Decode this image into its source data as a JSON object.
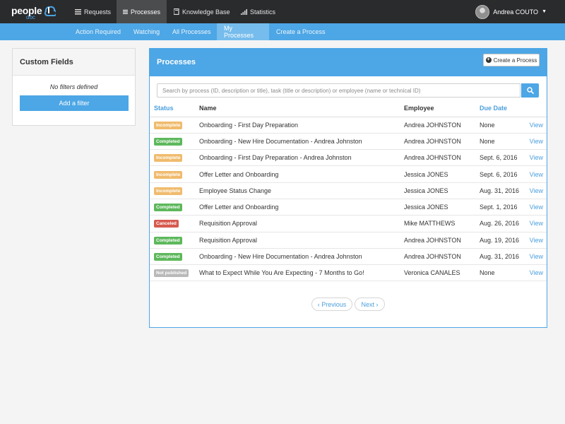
{
  "brand": {
    "word1": "people",
    "word2": "doc"
  },
  "topnav": [
    {
      "label": "Requests",
      "icon": "list-icon",
      "active": false
    },
    {
      "label": "Processes",
      "icon": "list-icon",
      "active": true
    },
    {
      "label": "Knowledge Base",
      "icon": "book-icon",
      "active": false
    },
    {
      "label": "Statistics",
      "icon": "bar-chart-icon",
      "active": false
    }
  ],
  "user": {
    "name": "Andrea COUTO"
  },
  "subnav": [
    {
      "label": "Action Required",
      "active": false
    },
    {
      "label": "Watching",
      "active": false
    },
    {
      "label": "All Processes",
      "active": false
    },
    {
      "label": "My Processes",
      "active": true
    },
    {
      "label": "Create a Process",
      "active": false
    }
  ],
  "custom_fields": {
    "title": "Custom Fields",
    "empty_text": "No filters defined",
    "add_label": "Add a filter"
  },
  "processes": {
    "title": "Processes",
    "create_label": "Create a Process",
    "search_placeholder": "Search by process (ID, description or title), task (title or description) or employee (name or technical ID)",
    "columns": {
      "status": "Status",
      "name": "Name",
      "employee": "Employee",
      "due": "Due Date"
    },
    "rows": [
      {
        "status": "Incomplete",
        "kind": "incomplete",
        "name": "Onboarding - First Day Preparation",
        "employee": "Andrea JOHNSTON",
        "due": "None",
        "action": "View"
      },
      {
        "status": "Completed",
        "kind": "completed",
        "name": "Onboarding - New Hire Documentation - Andrea Johnston",
        "employee": "Andrea JOHNSTON",
        "due": "None",
        "action": "View"
      },
      {
        "status": "Incomplete",
        "kind": "incomplete",
        "name": "Onboarding - First Day Preparation - Andrea Johnston",
        "employee": "Andrea JOHNSTON",
        "due": "Sept. 6, 2016",
        "action": "View"
      },
      {
        "status": "Incomplete",
        "kind": "incomplete",
        "name": "Offer Letter and Onboarding",
        "employee": "Jessica JONES",
        "due": "Sept. 6, 2016",
        "action": "View"
      },
      {
        "status": "Incomplete",
        "kind": "incomplete",
        "name": "Employee Status Change",
        "employee": "Jessica JONES",
        "due": "Aug. 31, 2016",
        "action": "View"
      },
      {
        "status": "Completed",
        "kind": "completed",
        "name": "Offer Letter and Onboarding",
        "employee": "Jessica JONES",
        "due": "Sept. 1, 2016",
        "action": "View"
      },
      {
        "status": "Canceled",
        "kind": "canceled",
        "name": "Requisition Approval",
        "employee": "Mike MATTHEWS",
        "due": "Aug. 26, 2016",
        "action": "View"
      },
      {
        "status": "Completed",
        "kind": "completed",
        "name": "Requisition Approval",
        "employee": "Andrea JOHNSTON",
        "due": "Aug. 19, 2016",
        "action": "View"
      },
      {
        "status": "Completed",
        "kind": "completed",
        "name": "Onboarding - New Hire Documentation - Andrea Johnston",
        "employee": "Andrea JOHNSTON",
        "due": "Aug. 31, 2016",
        "action": "View"
      },
      {
        "status": "Not published",
        "kind": "notpublished",
        "name": "What to Expect While You Are Expecting - 7 Months to Go!",
        "employee": "Veronica CANALES",
        "due": "None",
        "action": "View"
      }
    ],
    "pager": {
      "prev": "‹ Previous",
      "next": "Next ›"
    }
  },
  "colors": {
    "accent": "#4da6e5",
    "topbar": "#2a2b2d",
    "incomplete": "#f0bb6e",
    "completed": "#5db85c",
    "canceled": "#d65a4f",
    "not_published": "#b9b9b9"
  }
}
